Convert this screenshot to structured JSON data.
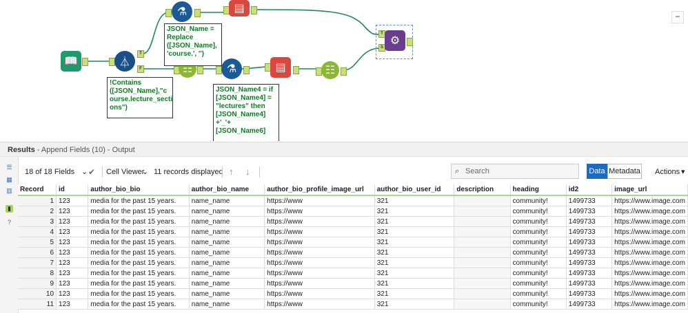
{
  "annotations": {
    "formula1": "JSON_Name =\nReplace\n([JSON_Name],\n'course.', '')",
    "filter": "!Contains\n([JSON_Name],\"c\nourse.lecture_secti\nons\")",
    "formula2": "JSON_Name4 = if\n[JSON_Name4] =\n\"lectures\" then\n[JSON_Name4]\n+'_'+\n[JSON_Name6]"
  },
  "anchors": {
    "true": "T",
    "false": "F",
    "target": "T",
    "source": "S"
  },
  "results": {
    "title": "Results",
    "subtitle": " - Append Fields (10) - Output"
  },
  "toolbar": {
    "fields": "18 of 18 Fields",
    "cell_viewer": "Cell Viewer",
    "records": "11 records displayed",
    "search_placeholder": "Search",
    "data_btn": "Data",
    "metadata_btn": "Metadata",
    "actions": "Actions"
  },
  "table": {
    "headers": [
      "Record",
      "id",
      "author_bio_bio",
      "author_bio_name",
      "author_bio_profile_image_url",
      "author_bio_user_id",
      "description",
      "heading",
      "id2",
      "image_url"
    ],
    "rows": [
      [
        "1",
        "123",
        "media for the past 15 years.",
        "name_name",
        "https://www",
        "321",
        "",
        "community!",
        "1499733",
        "https://www.image.com"
      ],
      [
        "2",
        "123",
        "media for the past 15 years.",
        "name_name",
        "https://www",
        "321",
        "",
        "community!",
        "1499733",
        "https://www.image.com"
      ],
      [
        "3",
        "123",
        "media for the past 15 years.",
        "name_name",
        "https://www",
        "321",
        "",
        "community!",
        "1499733",
        "https://www.image.com"
      ],
      [
        "4",
        "123",
        "media for the past 15 years.",
        "name_name",
        "https://www",
        "321",
        "",
        "community!",
        "1499733",
        "https://www.image.com"
      ],
      [
        "5",
        "123",
        "media for the past 15 years.",
        "name_name",
        "https://www",
        "321",
        "",
        "community!",
        "1499733",
        "https://www.image.com"
      ],
      [
        "6",
        "123",
        "media for the past 15 years.",
        "name_name",
        "https://www",
        "321",
        "",
        "community!",
        "1499733",
        "https://www.image.com"
      ],
      [
        "7",
        "123",
        "media for the past 15 years.",
        "name_name",
        "https://www",
        "321",
        "",
        "community!",
        "1499733",
        "https://www.image.com"
      ],
      [
        "8",
        "123",
        "media for the past 15 years.",
        "name_name",
        "https://www",
        "321",
        "",
        "community!",
        "1499733",
        "https://www.image.com"
      ],
      [
        "9",
        "123",
        "media for the past 15 years.",
        "name_name",
        "https://www",
        "321",
        "",
        "community!",
        "1499733",
        "https://www.image.com"
      ],
      [
        "10",
        "123",
        "media for the past 15 years.",
        "name_name",
        "https://www",
        "321",
        "",
        "community!",
        "1499733",
        "https://www.image.com"
      ],
      [
        "11",
        "123",
        "media for the past 15 years.",
        "name_name",
        "https://www",
        "321",
        "",
        "community!",
        "1499733",
        "https://www.image.com"
      ]
    ]
  },
  "colors": {
    "wire": "#1e8a56",
    "accent": "#1b6bc4",
    "annotation_text": "#117a26"
  }
}
